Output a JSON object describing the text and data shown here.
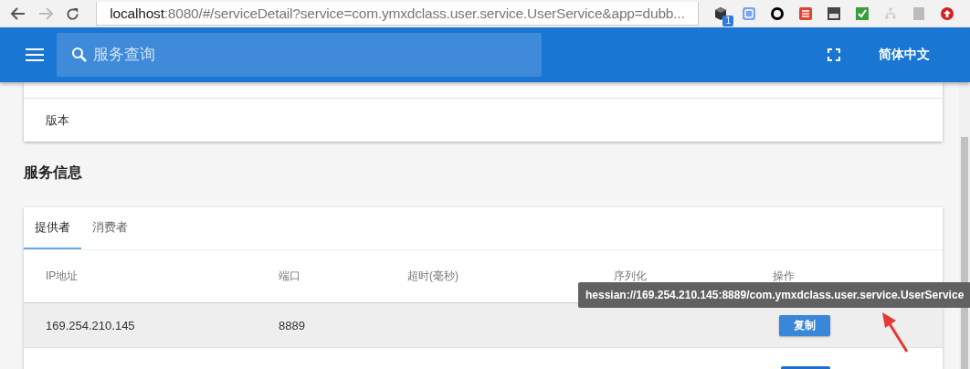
{
  "browser": {
    "url_host": "localhost",
    "url_rest": ":8080/#/serviceDetail?service=com.ymxdclass.user.service.UserService&app=dubb...",
    "extension_badge": "1"
  },
  "app_bar": {
    "search_placeholder": "服务查询",
    "language": "简体中文"
  },
  "basic_info": {
    "rows": [
      {
        "label": "版本"
      }
    ]
  },
  "section_title": "服务信息",
  "tabs": [
    {
      "label": "提供者",
      "selected": true
    },
    {
      "label": "消费者",
      "selected": false
    }
  ],
  "table": {
    "columns": [
      "IP地址",
      "端口",
      "超时(毫秒)",
      "序列化",
      "操作"
    ],
    "rows": [
      {
        "cells": [
          "169.254.210.145",
          "8889"
        ],
        "action": "复制",
        "highlighted": true
      }
    ]
  },
  "tooltip": "hessian://169.254.210.145:8889/com.ymxdclass.user.service.UserService"
}
